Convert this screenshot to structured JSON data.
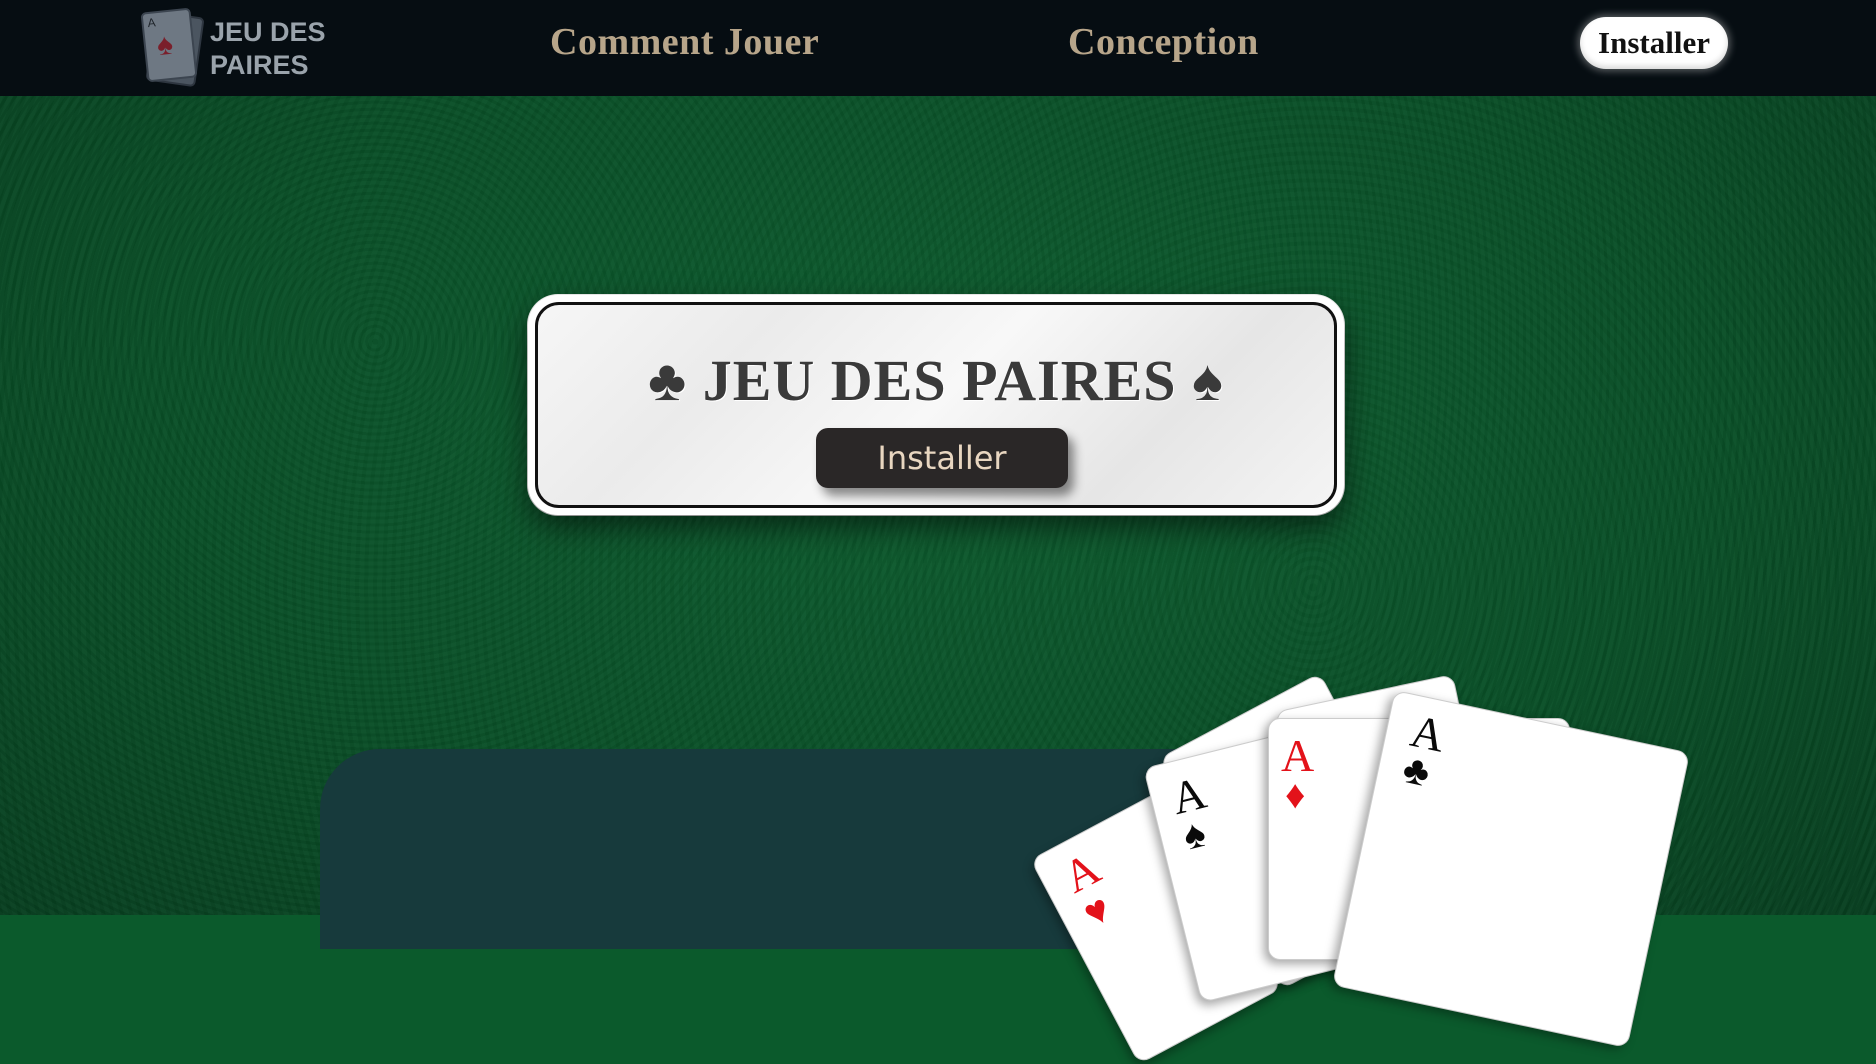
{
  "nav": {
    "logo_text": "JEU DES\nPAIRES",
    "logo_card_rank": "A",
    "logo_card_suit": "♠",
    "links": [
      {
        "label": "Comment Jouer"
      },
      {
        "label": "Conception"
      }
    ],
    "install_label": "Installer"
  },
  "hero": {
    "title": "♣ JEU DES PAIRES ♠",
    "button_label": "Installer"
  },
  "cards": [
    {
      "rank": "A",
      "suit": "♥",
      "color": "red"
    },
    {
      "rank": "A",
      "suit": "♠",
      "color": "black"
    },
    {
      "rank": "A",
      "suit": "♦",
      "color": "red"
    },
    {
      "rank": "A",
      "suit": "♣",
      "color": "black"
    }
  ],
  "colors": {
    "felt": "#0b5a2c",
    "navbar": "#060d12",
    "nav_link": "#b7a58a",
    "panel": "#173a3c",
    "button_dark": "#2a2727"
  }
}
